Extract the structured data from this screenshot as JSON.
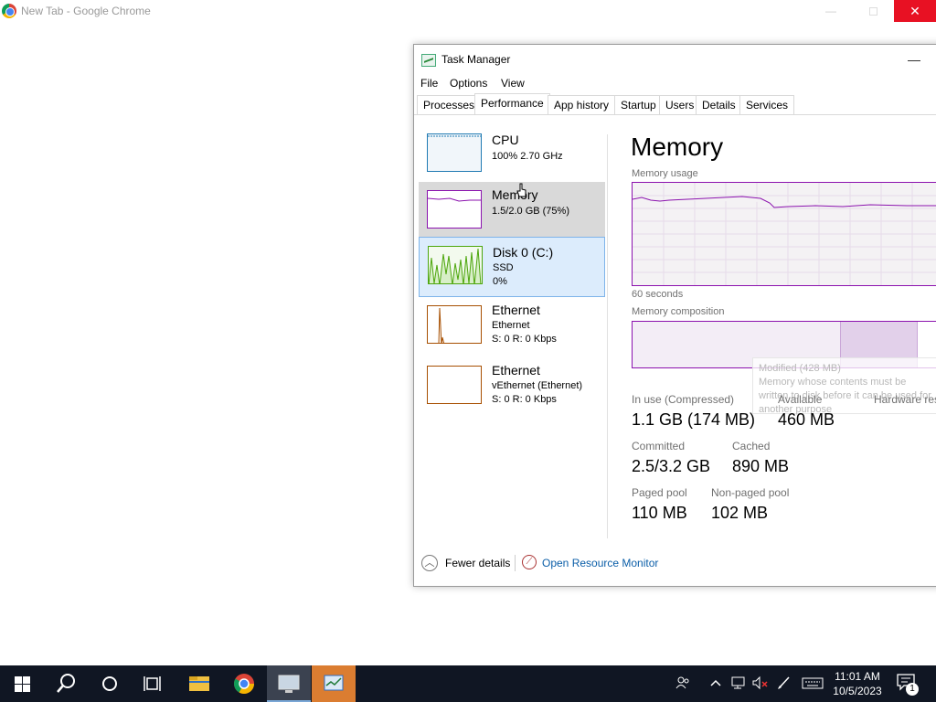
{
  "chrome": {
    "title": "New Tab - Google Chrome",
    "minimize_glyph": "—",
    "close_glyph": "✕"
  },
  "taskmanager": {
    "title": "Task Manager",
    "minimize_glyph": "—",
    "menu": [
      "File",
      "Options",
      "View"
    ],
    "tabs": [
      "Processes",
      "Performance",
      "App history",
      "Startup",
      "Users",
      "Details",
      "Services"
    ],
    "active_tab": "Performance",
    "resources": [
      {
        "name": "CPU",
        "line1": "100% 2.70 GHz",
        "line2": "",
        "color": "#1f7ab3"
      },
      {
        "name": "Memory",
        "line1": "1.5/2.0 GB (75%)",
        "line2": "",
        "color": "#8b12ae"
      },
      {
        "name": "Disk 0 (C:)",
        "line1": "SSD",
        "line2": "0%",
        "color": "#4da60c"
      },
      {
        "name": "Ethernet",
        "line1": "Ethernet",
        "line2": "S: 0 R: 0 Kbps",
        "color": "#a74f01"
      },
      {
        "name": "Ethernet",
        "line1": "vEthernet (Ethernet)",
        "line2": "S: 0 R: 0 Kbps",
        "color": "#a74f01"
      }
    ],
    "panel": {
      "title": "Memory",
      "usage_label": "Memory usage",
      "seconds_label": "60 seconds",
      "composition_label": "Memory composition",
      "tooltip_title": "Modified (428 MB)",
      "tooltip_body": "Memory whose contents must be written to disk before it can be used for another purpose",
      "stats": {
        "in_use_label": "In use (Compressed)",
        "in_use_value": "1.1 GB (174 MB)",
        "available_label": "Available",
        "available_value": "460 MB",
        "hardware_label": "Hardware res",
        "committed_label": "Committed",
        "committed_value": "2.5/3.2 GB",
        "cached_label": "Cached",
        "cached_value": "890 MB",
        "paged_label": "Paged pool",
        "paged_value": "110 MB",
        "nonpaged_label": "Non-paged pool",
        "nonpaged_value": "102 MB"
      }
    },
    "footer": {
      "fewer_details": "Fewer details",
      "open_resource_monitor": "Open Resource Monitor"
    }
  },
  "taskbar": {
    "clock_time": "11:01 AM",
    "clock_date": "10/5/2023",
    "notification_count": "1"
  },
  "colors": {
    "memory_accent": "#8b12ae",
    "disk_accent": "#4da60c",
    "cpu_accent": "#1f7ab3",
    "ethernet_accent": "#a74f01",
    "taskbar_bg": "#101623"
  },
  "icons": [
    "chrome-icon",
    "task-manager-icon",
    "windows-start-icon",
    "search-icon",
    "cortana-icon",
    "task-view-icon",
    "file-explorer-icon",
    "people-icon",
    "network-icon",
    "volume-muted-icon",
    "pen-icon",
    "keyboard-icon",
    "notification-icon",
    "resource-monitor-icon",
    "chevron-up-icon"
  ]
}
